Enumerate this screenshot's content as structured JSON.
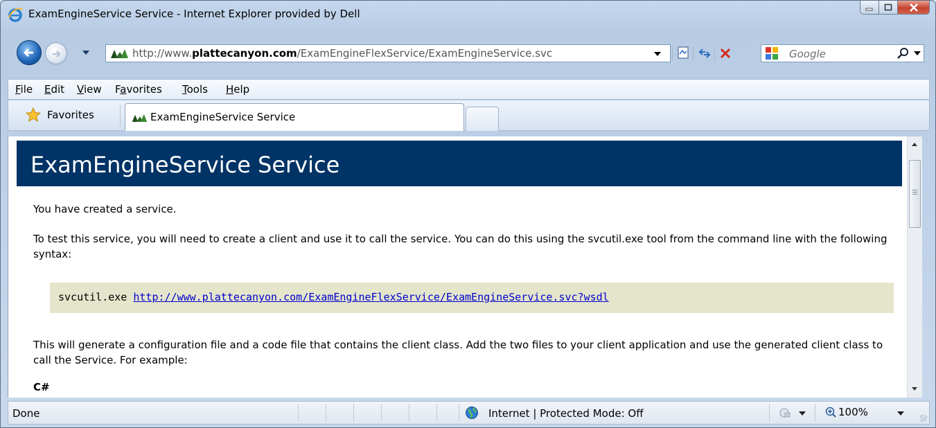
{
  "window": {
    "title": "ExamEngineService Service - Internet Explorer provided by Dell",
    "controls": [
      "minimize",
      "maximize",
      "close"
    ]
  },
  "address_bar": {
    "url_prefix": "http://www.",
    "url_domain": "plattecanyon.com",
    "url_path": "/ExamEngineFlexService/ExamEngineService.svc"
  },
  "search": {
    "placeholder": "Google"
  },
  "menu": {
    "items": [
      {
        "access": "F",
        "rest": "ile"
      },
      {
        "access": "E",
        "rest": "dit"
      },
      {
        "access": "V",
        "rest": "iew"
      },
      {
        "pre": "F",
        "access": "a",
        "rest": "vorites"
      },
      {
        "access": "T",
        "rest": "ools"
      },
      {
        "access": "H",
        "rest": "elp"
      }
    ]
  },
  "favorites_bar": {
    "label": "Favorites",
    "tab_label": "ExamEngineService Service"
  },
  "page": {
    "heading": "ExamEngineService Service",
    "p1": "You have created a service.",
    "p2": "To test this service, you will need to create a client and use it to call the service. You can do this using the svcutil.exe tool from the command line with the following syntax:",
    "code_cmd": "svcutil.exe",
    "code_link": "http://www.plattecanyon.com/ExamEngineFlexService/ExamEngineService.svc?wsdl",
    "p3": "This will generate a configuration file and a code file that contains the client class. Add the two files to your client application and use the generated client class to call the Service. For example:",
    "csharp": "C#"
  },
  "status_bar": {
    "status": "Done",
    "zone": "Internet | Protected Mode: Off",
    "zoom": "100%"
  },
  "colors": {
    "heading_band": "#003366",
    "code_background": "#e5e5cc",
    "link": "#0000cc",
    "close_button": "#c6442f"
  },
  "icons": [
    "ie-logo-icon",
    "back-arrow-icon",
    "forward-arrow-icon",
    "site-favicon-icon",
    "compatibility-view-icon",
    "refresh-icon",
    "stop-icon",
    "google-icon",
    "search-icon",
    "favorites-star-icon",
    "globe-icon",
    "protected-mode-icon",
    "zoom-icon"
  ]
}
